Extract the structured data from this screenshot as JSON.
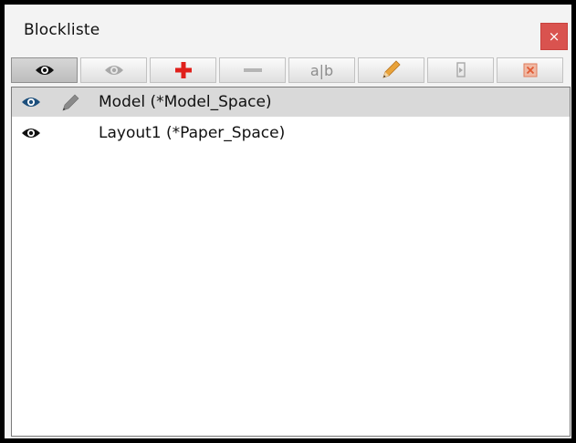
{
  "window": {
    "title": "Blockliste",
    "close_glyph": "×"
  },
  "toolbar": {
    "buttons": [
      {
        "name": "show-all",
        "icon": "eye-icon",
        "state": "active"
      },
      {
        "name": "hide-all",
        "icon": "eye-icon",
        "state": "disabled"
      },
      {
        "name": "add",
        "icon": "plus-icon",
        "state": "enabled"
      },
      {
        "name": "remove",
        "icon": "minus-icon",
        "state": "disabled"
      },
      {
        "name": "rename",
        "icon": "rename-icon",
        "label": "a|b",
        "state": "disabled"
      },
      {
        "name": "edit",
        "icon": "pencil-icon",
        "state": "enabled"
      },
      {
        "name": "insert",
        "icon": "insert-icon",
        "state": "disabled"
      },
      {
        "name": "close-editor",
        "icon": "close-box-icon",
        "state": "disabled"
      }
    ]
  },
  "blocks": [
    {
      "label": "Model (*Model_Space)",
      "visible": true,
      "editing": true,
      "selected": true
    },
    {
      "label": "Layout1 (*Paper_Space)",
      "visible": true,
      "editing": false,
      "selected": false
    }
  ],
  "colors": {
    "close_button": "#d9534f",
    "plus": "#e0201b",
    "pencil": "#e9a33a",
    "selection": "#d9d9d9",
    "eye_active": "#1d4f7c"
  }
}
